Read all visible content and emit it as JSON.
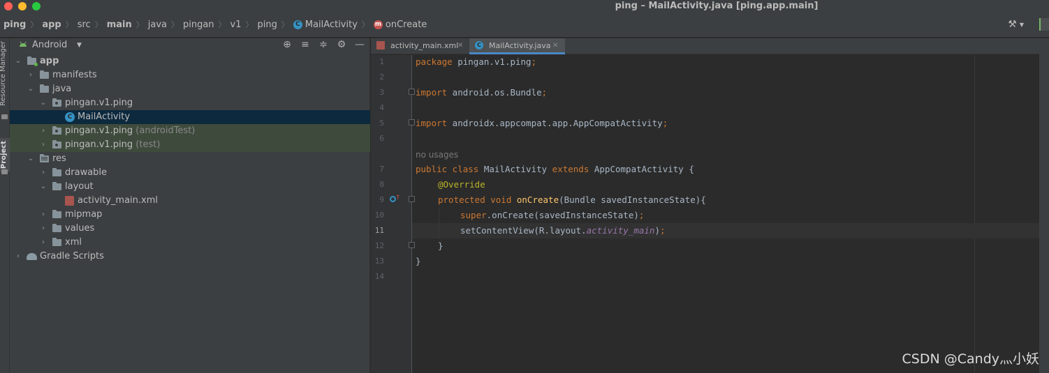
{
  "window": {
    "title": "ping – MailActivity.java [ping.app.main]"
  },
  "breadcrumb": {
    "items": [
      {
        "label": "ping",
        "bold": true
      },
      {
        "label": "app",
        "bold": true
      },
      {
        "label": "src"
      },
      {
        "label": "main",
        "bold": true
      },
      {
        "label": "java"
      },
      {
        "label": "pingan"
      },
      {
        "label": "v1"
      },
      {
        "label": "ping"
      },
      {
        "label": "MailActivity",
        "icon": "class-icon"
      },
      {
        "label": "onCreate",
        "icon": "method-icon"
      }
    ],
    "separator": "〉"
  },
  "toolstrip": {
    "resource_manager": "Resource Manager",
    "project": "Project"
  },
  "project_panel": {
    "view_mode": "Android",
    "tree": [
      {
        "label": "app",
        "bold": true,
        "indent": 0,
        "expanded": true,
        "icon": "module-folder-icon"
      },
      {
        "label": "manifests",
        "indent": 1,
        "expanded": false,
        "icon": "folder-icon"
      },
      {
        "label": "java",
        "indent": 1,
        "expanded": true,
        "icon": "folder-icon"
      },
      {
        "label": "pingan.v1.ping",
        "indent": 2,
        "expanded": true,
        "icon": "package-icon"
      },
      {
        "label": "MailActivity",
        "indent": 3,
        "icon": "class-icon",
        "selected": true
      },
      {
        "label": "pingan.v1.ping",
        "suffix": "(androidTest)",
        "indent": 2,
        "expanded": false,
        "icon": "package-icon",
        "test": true
      },
      {
        "label": "pingan.v1.ping",
        "suffix": "(test)",
        "indent": 2,
        "expanded": false,
        "icon": "package-icon",
        "test": true
      },
      {
        "label": "res",
        "indent": 1,
        "expanded": true,
        "icon": "resource-folder-icon"
      },
      {
        "label": "drawable",
        "indent": 2,
        "expanded": false,
        "icon": "folder-icon"
      },
      {
        "label": "layout",
        "indent": 2,
        "expanded": true,
        "icon": "folder-icon"
      },
      {
        "label": "activity_main.xml",
        "indent": 3,
        "icon": "xml-file-icon"
      },
      {
        "label": "mipmap",
        "indent": 2,
        "expanded": false,
        "icon": "folder-icon"
      },
      {
        "label": "values",
        "indent": 2,
        "expanded": false,
        "icon": "folder-icon"
      },
      {
        "label": "xml",
        "indent": 2,
        "expanded": false,
        "icon": "folder-icon"
      },
      {
        "label": "Gradle Scripts",
        "indent": 0,
        "expanded": false,
        "icon": "gradle-icon"
      }
    ]
  },
  "editor": {
    "tabs": [
      {
        "label": "activity_main.xml",
        "icon": "xml-file-icon",
        "active": false
      },
      {
        "label": "MailActivity.java",
        "icon": "class-icon",
        "active": true
      }
    ],
    "current_line": 11,
    "hint_text": "no usages",
    "lines": [
      {
        "n": "1"
      },
      {
        "n": "2"
      },
      {
        "n": "3"
      },
      {
        "n": "4"
      },
      {
        "n": "5"
      },
      {
        "n": "6"
      },
      {
        "n": "7"
      },
      {
        "n": "8"
      },
      {
        "n": "9"
      },
      {
        "n": "10"
      },
      {
        "n": "11"
      },
      {
        "n": "12"
      },
      {
        "n": "13"
      },
      {
        "n": "14"
      }
    ],
    "code": {
      "l1_kw": "package",
      "l1_rest": " pingan.v1.ping",
      "l1_semi": ";",
      "l3_kw": "import",
      "l3_rest": " android.os.Bundle",
      "l3_semi": ";",
      "l5_kw": "import",
      "l5_rest": " androidx.appcompat.app.AppCompatActivity",
      "l5_semi": ";",
      "l7_kw1": "public class",
      "l7_name": " MailActivity ",
      "l7_kw2": "extends",
      "l7_rest": " AppCompatActivity {",
      "l8_ann": "@Override",
      "l9_kw": "protected void",
      "l9_fn": " onCreate",
      "l9_rest": "(Bundle savedInstanceState){",
      "l10_kw": "super",
      "l10_rest": ".onCreate(savedInstanceState)",
      "l10_semi": ";",
      "l11_a": "setContentView(R.layout.",
      "l11_it": "activity_main",
      "l11_b": ")",
      "l11_semi": ";",
      "l12": "}",
      "l13": "}"
    }
  },
  "watermark": "CSDN @Candy灬小妖"
}
